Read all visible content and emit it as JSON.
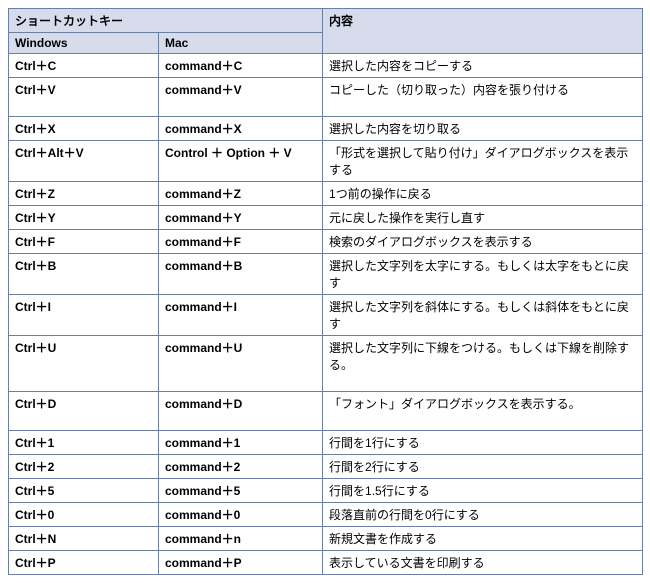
{
  "headers": {
    "shortcut": "ショートカットキー",
    "windows": "Windows",
    "mac": "Mac",
    "content": "内容"
  },
  "rows": [
    {
      "win": "Ctrl＋C",
      "mac": "command＋C",
      "desc": "選択した内容をコピーする"
    },
    {
      "win": "Ctrl＋V",
      "mac": "command＋V",
      "desc": "コピーした（切り取った）内容を張り付ける",
      "descCls": "",
      "descPad": true
    },
    {
      "win": "Ctrl＋X",
      "mac": "command＋X",
      "desc": "選択した内容を切り取る"
    },
    {
      "win": "Ctrl＋Alt＋V",
      "mac": "Control ＋ Option ＋ V",
      "desc": "「形式を選択して貼り付け」ダイアログボックスを表示する"
    },
    {
      "win": "Ctrl＋Z",
      "mac": "command＋Z",
      "desc": "1つ前の操作に戻る"
    },
    {
      "win": "Ctrl＋Y",
      "mac": "command＋Y",
      "desc": "元に戻した操作を実行し直す"
    },
    {
      "win": "Ctrl＋F",
      "mac": "command＋F",
      "desc": "検索のダイアログボックスを表示する"
    },
    {
      "win": "Ctrl＋B",
      "mac": "command＋B",
      "desc": "選択した文字列を太字にする。もしくは太字をもとに戻す"
    },
    {
      "win": "Ctrl＋I",
      "mac": "command＋I",
      "desc": "選択した文字列を斜体にする。もしくは斜体をもとに戻す"
    },
    {
      "win": "Ctrl＋U",
      "mac": "command＋U",
      "desc": "選択した文字列に下線をつける。もしくは下線を削除する。",
      "descPad": true
    },
    {
      "win": "Ctrl＋D",
      "mac": "command＋D",
      "desc": "「フォント」ダイアログボックスを表示する。",
      "descPad": true
    },
    {
      "win": "Ctrl＋1",
      "mac": "command＋1",
      "desc": "行間を1行にする"
    },
    {
      "win": "Ctrl＋2",
      "mac": "command＋2",
      "desc": "行間を2行にする"
    },
    {
      "win": "Ctrl＋5",
      "mac": "command＋5",
      "desc": "行間を1.5行にする"
    },
    {
      "win": "Ctrl＋0",
      "mac": "command＋0",
      "desc": "段落直前の行間を0行にする"
    },
    {
      "win": "Ctrl＋N",
      "mac": "command＋n",
      "desc": "新規文書を作成する"
    },
    {
      "win": "Ctrl＋P",
      "mac": "command＋P",
      "desc": "表示している文書を印刷する"
    }
  ]
}
